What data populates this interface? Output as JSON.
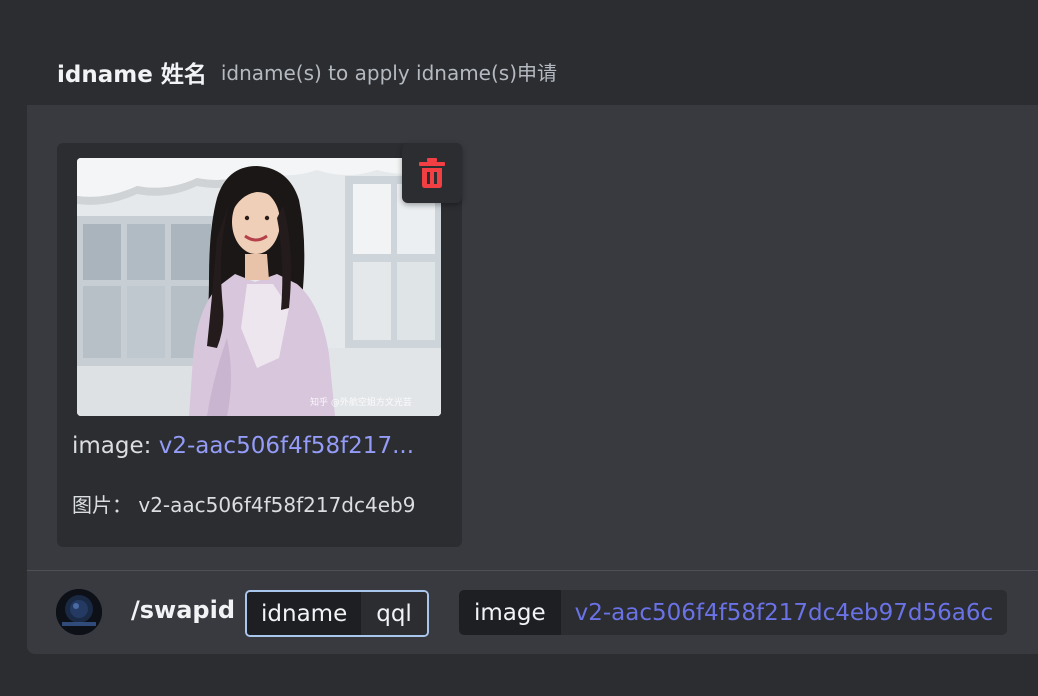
{
  "header": {
    "command_name": "idname 姓名",
    "command_description": "idname(s) to apply idname(s)申请"
  },
  "attachment": {
    "image_label": "image:",
    "image_value": "v2-aac506f4f58f217...",
    "filename_label": "图片：",
    "filename_value": "v2-aac506f4f58f217dc4eb9",
    "thumbnail_watermark": "知乎 @外航空姐方文光芸",
    "delete_icon": "trash-icon",
    "delete_icon_color": "#f23f43"
  },
  "command_bar": {
    "command": "/swapid",
    "options": [
      {
        "key": "idname",
        "value": "qql"
      },
      {
        "key": "image",
        "value": "v2-aac506f4f58f217dc4eb97d56a6c"
      }
    ]
  },
  "colors": {
    "background": "#2b2d31",
    "panel": "#383a40",
    "link": "#949cf7",
    "option_value_link": "#6a72e6",
    "focus_border": "#a9c6ec"
  }
}
